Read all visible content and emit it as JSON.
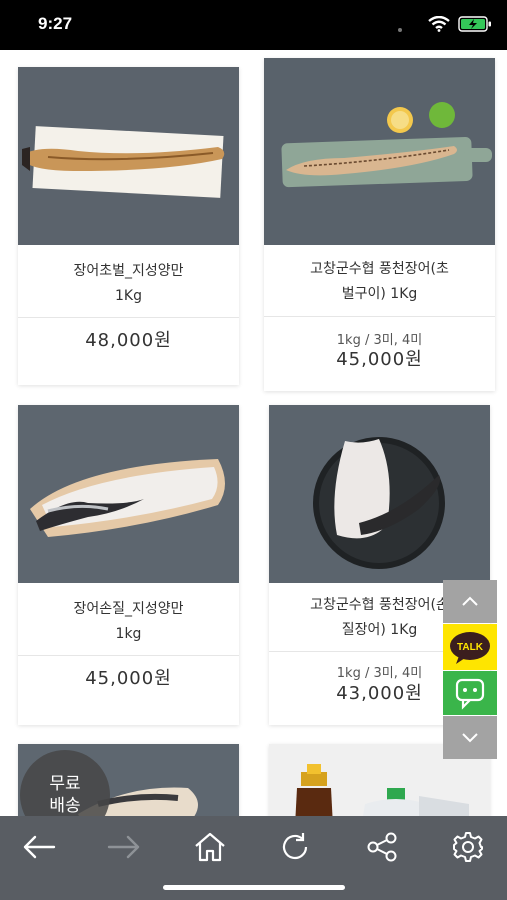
{
  "status_bar": {
    "time": "9:27"
  },
  "products": [
    {
      "name_line1": "장어초벌_지성양만",
      "name_line2": "1Kg",
      "option": "",
      "price": "48,000원"
    },
    {
      "name_line1": "고창군수협 풍천장어(초",
      "name_line2": "벌구이) 1Kg",
      "option": "1kg / 3미, 4미",
      "price": "45,000원"
    },
    {
      "name_line1": "장어손질_지성양만",
      "name_line2": "1kg",
      "option": "",
      "price": "45,000원"
    },
    {
      "name_line1": "고창군수협 풍천장어(손",
      "name_line2": "질장어) 1Kg",
      "option": "1kg / 3미, 4미",
      "price": "43,000원"
    }
  ],
  "free_shipping_badge": {
    "line1": "무료",
    "line2": "배송"
  },
  "floating_buttons": {
    "talk_label": "TALK"
  },
  "colors": {
    "kakao_yellow": "#fee500",
    "chat_green": "#3ab54a",
    "nav_bg": "#595d63",
    "scroll_btn_bg": "#9a9a9a"
  },
  "bottom_nav": {
    "icons": [
      "back-arrow-icon",
      "forward-arrow-icon",
      "home-icon",
      "refresh-icon",
      "share-icon",
      "settings-icon"
    ]
  }
}
